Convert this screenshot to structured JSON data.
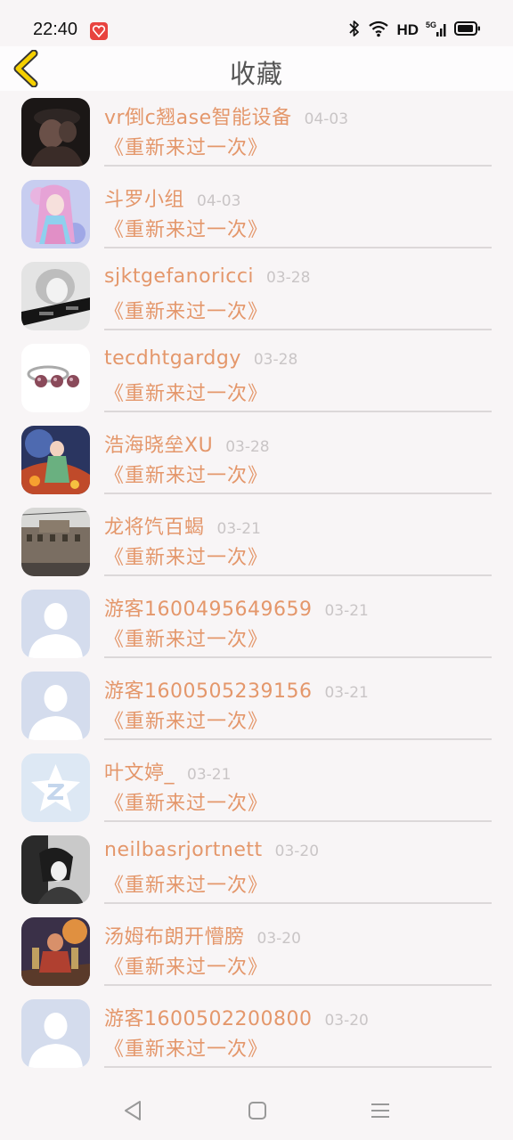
{
  "status_bar": {
    "time": "22:40",
    "network": "HD"
  },
  "header": {
    "title": "收藏"
  },
  "items": [
    {
      "name": "vr倒c翘ase智能设备",
      "date": "04-03",
      "book": "《重新来过一次》",
      "avatar": "photo"
    },
    {
      "name": "斗罗小组",
      "date": "04-03",
      "book": "《重新来过一次》",
      "avatar": "anime-girl"
    },
    {
      "name": "sjktgefanoricci",
      "date": "03-28",
      "book": "《重新来过一次》",
      "avatar": "bw-portrait"
    },
    {
      "name": "tecdhtgardgy",
      "date": "03-28",
      "book": "《重新来过一次》",
      "avatar": "pearl-ring"
    },
    {
      "name": "浩海晓垒XU",
      "date": "03-28",
      "book": "《重新来过一次》",
      "avatar": "fantasy"
    },
    {
      "name": "龙将饩百蝎",
      "date": "03-21",
      "book": "《重新来过一次》",
      "avatar": "building"
    },
    {
      "name": "游客1600495649659",
      "date": "03-21",
      "book": "《重新来过一次》",
      "avatar": "default"
    },
    {
      "name": "游客1600505239156",
      "date": "03-21",
      "book": "《重新来过一次》",
      "avatar": "default"
    },
    {
      "name": "叶文婷_",
      "date": "03-21",
      "book": "《重新来过一次》",
      "avatar": "qzone"
    },
    {
      "name": "neilbasrjortnett",
      "date": "03-20",
      "book": "《重新来过一次》",
      "avatar": "bw-girl"
    },
    {
      "name": "汤姆布朗开懵膀",
      "date": "03-20",
      "book": "《重新来过一次》",
      "avatar": "game"
    },
    {
      "name": "游客1600502200800",
      "date": "03-20",
      "book": "《重新来过一次》",
      "avatar": "default"
    }
  ],
  "colors": {
    "accent": "#e4976b",
    "date": "#c9c5c6",
    "divider": "#dcd8d9",
    "back_arrow": "#f5d000"
  },
  "nav": [
    "back-triangle-icon",
    "home-square-icon",
    "menu-lines-icon"
  ]
}
